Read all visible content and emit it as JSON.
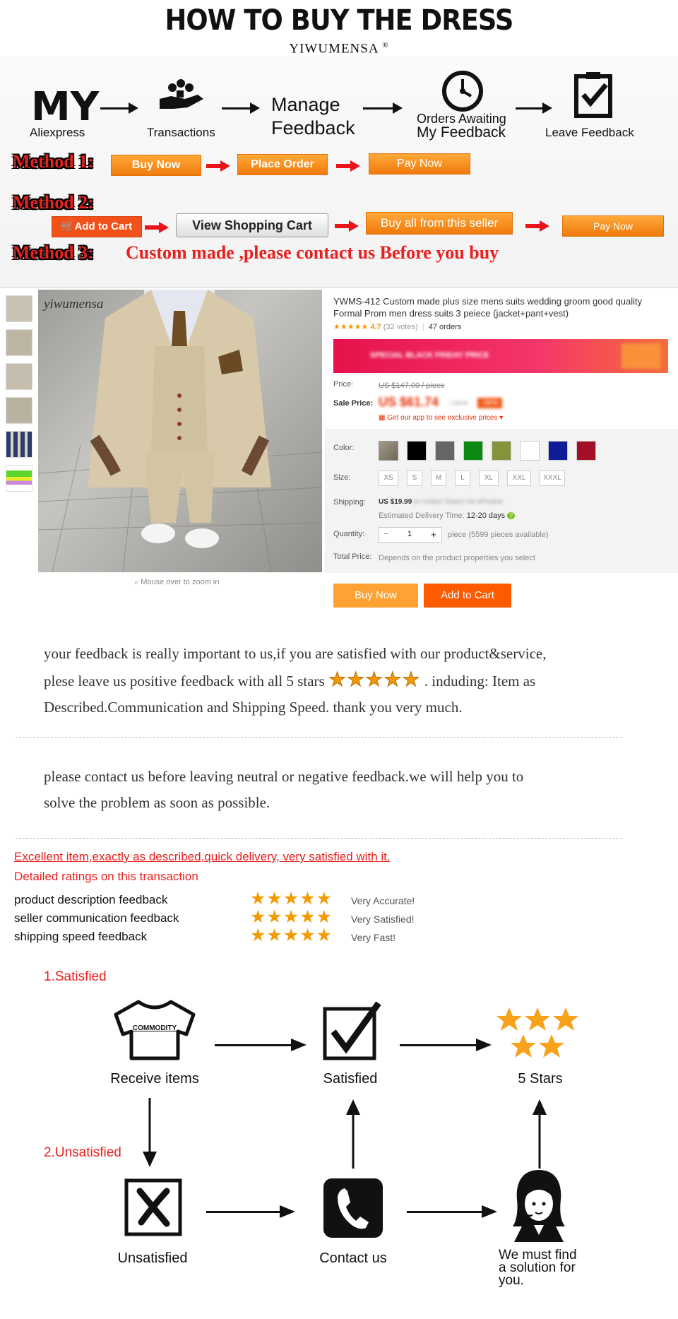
{
  "header": {
    "title": "HOW TO BUY THE DRESS",
    "brand": "YIWUMENSA",
    "registered": "®"
  },
  "steps": {
    "my": "MY",
    "aliexpress": "Aliexpress",
    "transactions": "Transactions",
    "manage": "Manage",
    "feedback": "Feedback",
    "orders_awaiting": "Orders Awaiting",
    "my_feedback": "My Feedback",
    "leave_feedback": "Leave Feedback"
  },
  "methods": {
    "method1": {
      "label": "Method 1:",
      "buttons": [
        "Buy Now",
        "Place Order",
        "Pay Now"
      ]
    },
    "method2": {
      "label": "Method 2:",
      "buttons": [
        "Add to Cart",
        "View Shopping Cart",
        "Buy all from this seller",
        "Pay Now"
      ]
    },
    "method3": {
      "label": "Method 3:",
      "text": "Custom  made ,please contact us Before you buy"
    }
  },
  "product": {
    "watermark": "yiwumensa",
    "zoom_hint": "Mouse over to zoom in",
    "title": "YWMS-412 Custom made plus size mens suits wedding groom good quality Formal Prom men dress suits 3 peiece (jacket+pant+vest)",
    "rating": "4.7",
    "votes": "(32 votes)",
    "orders": "47 orders",
    "promo_text": "SPECIAL BLACK FRIDAY PRICE",
    "price_label": "Price:",
    "price_value": "US $147.00 / piece",
    "sale_label": "Sale Price:",
    "sale_value": "US $61.74",
    "sale_unit": "/ piece",
    "discount": "-58%",
    "app_link": "Get our app to see exclusive prices",
    "color_label": "Color:",
    "colors": [
      "#8a8270",
      "#000000",
      "#666666",
      "#0b8a12",
      "#83943a",
      "#ffffff",
      "#0e1d97",
      "#a20f26"
    ],
    "size_label": "Size:",
    "sizes": [
      "XS",
      "S",
      "M",
      "L",
      "XL",
      "XXL",
      "XXXL"
    ],
    "shipping_label": "Shipping:",
    "shipping_value": "US $19.99",
    "shipping_via": "to United States via ePacket",
    "delivery_label": "Estimated Delivery Time:",
    "delivery_value": "12-20 days",
    "quantity_label": "Quantity:",
    "quantity_value": "1",
    "minus": "−",
    "plus": "+",
    "pieces_available": "piece (5599 pieces available)",
    "total_label": "Total Price:",
    "total_value": "Depends on the product properties you select",
    "buy_now": "Buy Now",
    "add_to_cart": "Add to Cart"
  },
  "feedback": {
    "para1_line1": "your feedback is really important to us,if you are satisfied with our product&service,",
    "para1_line2a": "plese leave us positive feedback with all 5 stars",
    "para1_line2b": ". induding: Item as",
    "para1_line3": "Described.Communication and Shipping Speed. thank you very much.",
    "para2_line1": "please contact us before leaving neutral or negative feedback.we will help you to",
    "para2_line2": "solve the problem as soon as possible.",
    "excellent": "Excellent item,exactly as described,quick delivery, very satisfied with it.",
    "detailed": "Detailed ratings on this transaction",
    "ratings": [
      {
        "label": "product description feedback",
        "value": "Very Accurate!"
      },
      {
        "label": "seller communication feedback",
        "value": "Very Satisfied!"
      },
      {
        "label": "shipping speed feedback",
        "value": "Very Fast!"
      }
    ],
    "stars": "★★★★★"
  },
  "flow": {
    "satisfied_heading": "1.Satisfied",
    "unsatisfied_heading": "2.Unsatisfied",
    "commodity": "COMMODITY",
    "receive_items": "Receive items",
    "satisfied": "Satisfied",
    "five_stars": "5 Stars",
    "unsatisfied": "Unsatisfied",
    "contact_us": "Contact us",
    "solution_line1": "We must find",
    "solution_line2": "a solution for",
    "solution_line3": "you."
  }
}
